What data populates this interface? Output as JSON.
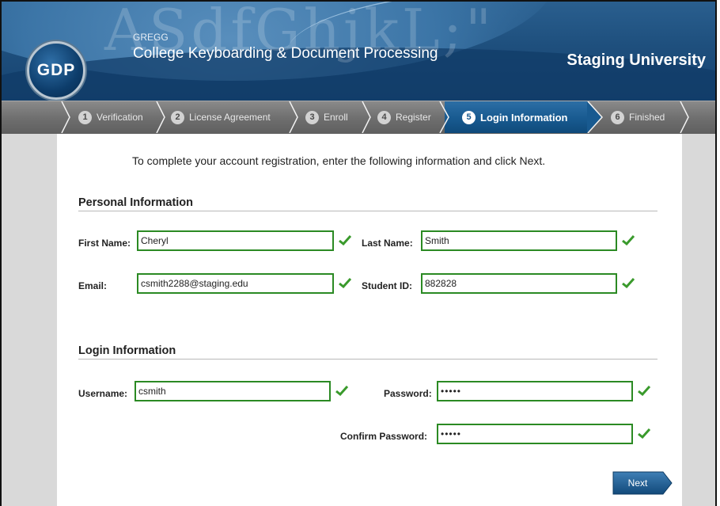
{
  "header": {
    "logo_text": "GDP",
    "brand_small": "GREGG",
    "brand_title": "College Keyboarding & Document Processing",
    "university": "Staging University",
    "bg_letters": "ASdfGhjkL;\""
  },
  "steps": [
    {
      "num": "1",
      "label": "Verification"
    },
    {
      "num": "2",
      "label": "License Agreement"
    },
    {
      "num": "3",
      "label": "Enroll"
    },
    {
      "num": "4",
      "label": "Register"
    },
    {
      "num": "5",
      "label": "Login Information"
    },
    {
      "num": "6",
      "label": "Finished"
    }
  ],
  "active_step": 5,
  "intro_text": "To complete your account registration, enter the following information and click Next.",
  "personal": {
    "title": "Personal Information",
    "first_name_label": "First Name:",
    "first_name_value": "Cheryl",
    "last_name_label": "Last Name:",
    "last_name_value": "Smith",
    "email_label": "Email:",
    "email_value": "csmith2288@staging.edu",
    "student_id_label": "Student ID:",
    "student_id_value": "882828"
  },
  "login": {
    "title": "Login Information",
    "username_label": "Username:",
    "username_value": "csmith",
    "password_label": "Password:",
    "password_value": "•••••",
    "confirm_label": "Confirm Password:",
    "confirm_value": "•••••"
  },
  "next_label": "Next",
  "colors": {
    "header_blue": "#1e4f7d",
    "active_step": "#185a90",
    "valid_green": "#2b8a23"
  }
}
